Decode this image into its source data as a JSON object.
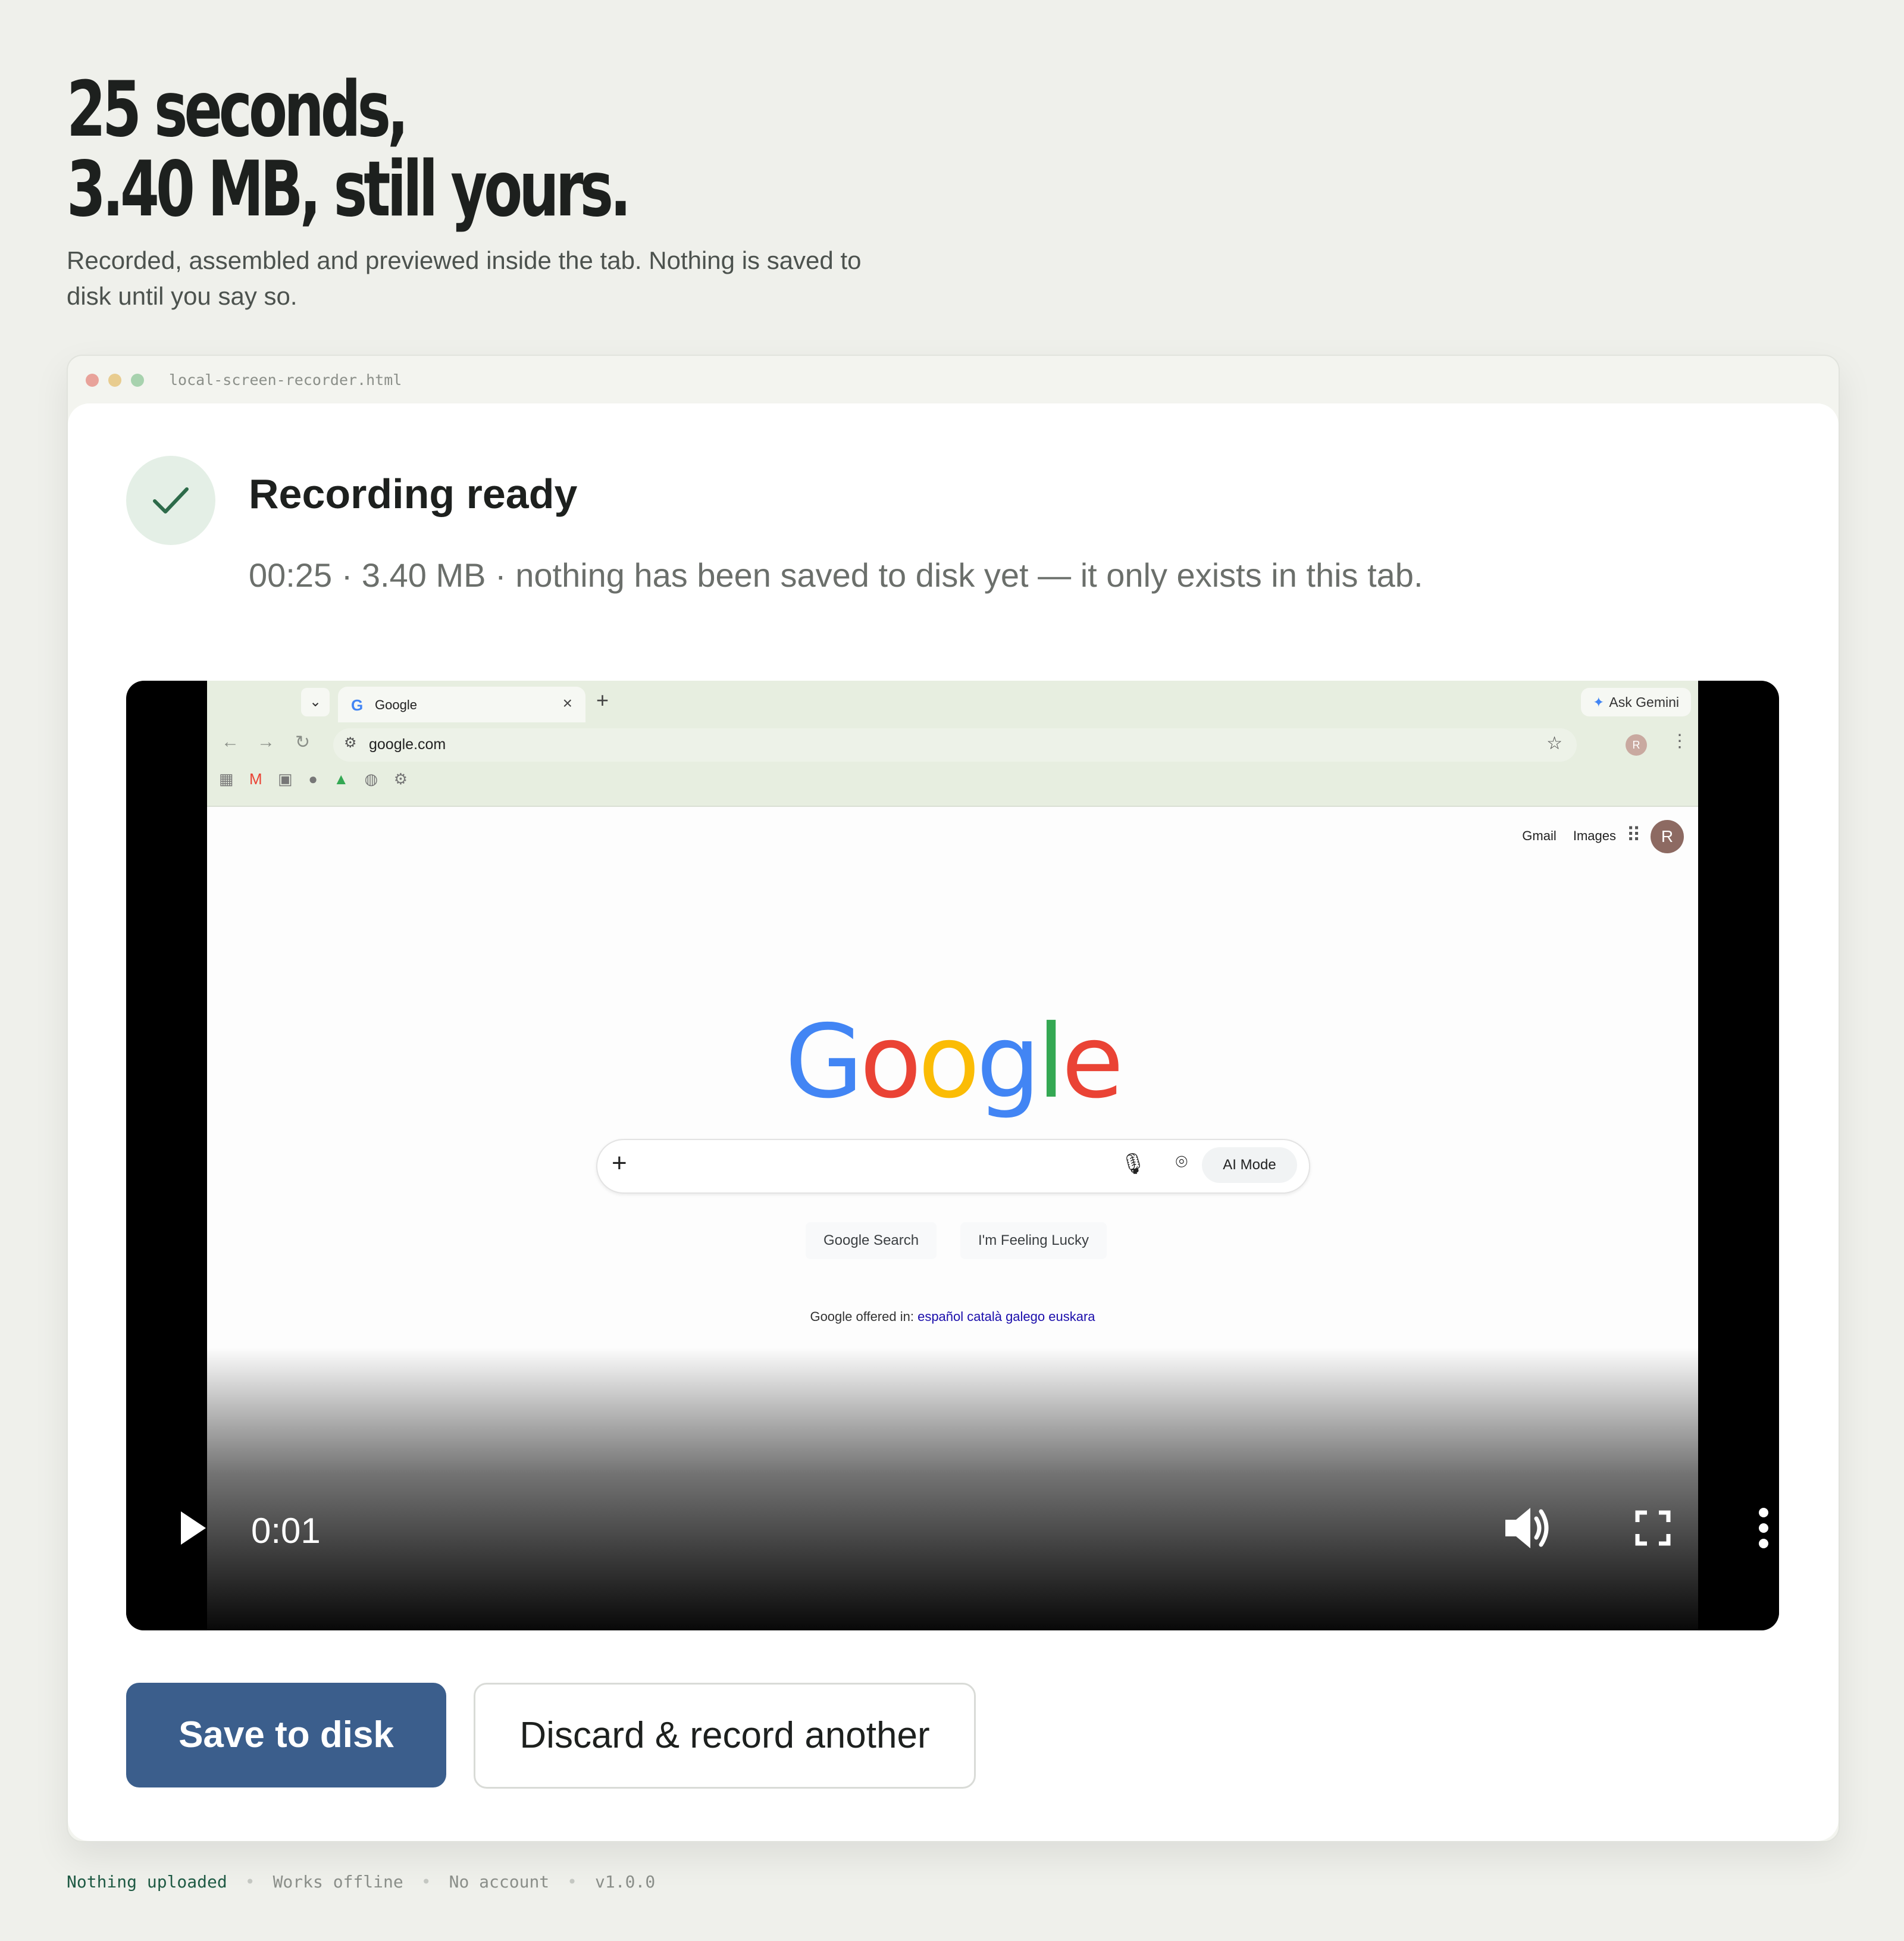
{
  "hero": {
    "line1": "25 seconds,",
    "line2": "3.40 MB, still yours.",
    "subtitle": "Recorded, assembled and previewed inside the tab. Nothing is saved to disk until you say so."
  },
  "window": {
    "title": "local-screen-recorder.html"
  },
  "status": {
    "title": "Recording ready",
    "meta": "00:25 · 3.40 MB · nothing has been saved to disk yet — it only exists in this tab."
  },
  "video": {
    "current_time": "0:01",
    "progress_fraction": 0.057,
    "controls": [
      "play-icon",
      "volume-icon",
      "fullscreen-icon",
      "more-vertical-icon"
    ]
  },
  "screen": {
    "tab_title": "Google",
    "ask_gemini": "Ask Gemini",
    "url": "google.com",
    "profile_initial": "R",
    "links": [
      "Gmail",
      "Images"
    ],
    "search_buttons": [
      "Google Search",
      "I'm Feeling Lucky"
    ],
    "ai_mode": "AI Mode",
    "offered_label": "Google offered in:",
    "offered_langs": "español català galego euskara",
    "logo": [
      {
        "ch": "G",
        "color": "#4285f4"
      },
      {
        "ch": "o",
        "color": "#ea4335"
      },
      {
        "ch": "o",
        "color": "#fbbc05"
      },
      {
        "ch": "g",
        "color": "#4285f4"
      },
      {
        "ch": "l",
        "color": "#34a853"
      },
      {
        "ch": "e",
        "color": "#ea4335"
      }
    ]
  },
  "actions": {
    "save": "Save to disk",
    "discard": "Discard & record another"
  },
  "footer": [
    "Nothing uploaded",
    "Works offline",
    "No account",
    "v1.0.0"
  ],
  "colors": {
    "accent": "#3b5e8c",
    "success_bg": "#e4efe6",
    "success_check": "#2d6b4a",
    "footer_highlight": "#1f5a44"
  }
}
